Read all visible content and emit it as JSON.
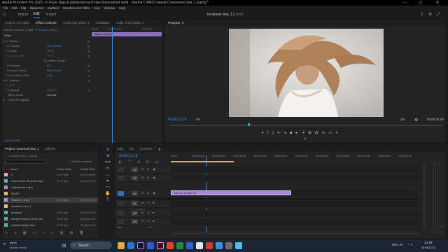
{
  "window": {
    "title": "Adobe Premiere Pro 2023 - F:\\Fiver Gigs & jobs\\External Projects\\Unnamed india - Diamid C\\PRO Diamid C\\renamed new_1.prproj *",
    "controls": "–  ▢  ✕"
  },
  "menu": [
    "File",
    "Edit",
    "Clip",
    "Sequence",
    "Markers",
    "Graphics and Titles",
    "View",
    "Window",
    "Help"
  ],
  "workspace": {
    "tabs": [
      "Import",
      "Edit",
      "Export"
    ],
    "active": "Edit",
    "doc_title": "renamed new_1",
    "doc_status": "Edited"
  },
  "source_panel": {
    "tabs": [
      "Source: (no clips)",
      "Effect Controls",
      "Audio Clip Mixer: 1",
      "Metadata",
      "Audio Track Mixer: 1"
    ],
    "active": "Effect Controls",
    "source_label": "Source • Source_3.mp4",
    "clip_label": "1 • Source_3.mp4",
    "timecode_start": "00;00",
    "timecode_mid": "00;00;16;00",
    "timecode_end": "00;00;32",
    "clip_bar_label": "Source_3.mp4",
    "video_label": "Video",
    "properties": [
      {
        "name": "Motion",
        "value": ""
      },
      {
        "name": "Position",
        "value": "960.0   540.0"
      },
      {
        "name": "Scale",
        "value": "100.0"
      },
      {
        "name": "Scale Width",
        "value": "100.0"
      },
      {
        "name": "",
        "value": "Uniform Scale"
      },
      {
        "name": "Rotation",
        "value": "0.0"
      },
      {
        "name": "Anchor Point",
        "value": "960.0   540.0"
      },
      {
        "name": "Anti-flicker Filter",
        "value": "0.00"
      },
      {
        "name": "Opacity",
        "value": ""
      },
      {
        "name": "Opacity",
        "value": "100.0 %"
      },
      {
        "name": "Blend Mode",
        "value": "Normal"
      },
      {
        "name": "Time Remapping",
        "value": ""
      }
    ],
    "bottom_timecode": "00;00;13;18"
  },
  "program": {
    "tab": "Program: 3",
    "timecode": "00;00;13;18",
    "fit": "Fit",
    "quality": "1/4",
    "duration": "00;00;32;28"
  },
  "project_panel": {
    "tabs": [
      "Project: renamed new_1",
      "Effects"
    ],
    "active": "Project: renamed new_1",
    "project_file": "renamed new_1.prproj",
    "selection_info": "1 of 9 items selected",
    "columns": [
      "Name",
      "Frame Rate",
      "Media Start"
    ],
    "items": [
      {
        "name": "2",
        "rate": "29.97 fps",
        "start": "00;00;00;00",
        "color": "#e8a6d0"
      },
      {
        "name": "2023-06-01 09-43-20.mp4",
        "rate": "29.97 fps",
        "start": "00;00;00;00",
        "color": "#57b3a6"
      },
      {
        "name": "Adjustment Layer",
        "rate": "",
        "start": "",
        "color": "#a890e0"
      },
      {
        "name": "BIGDY",
        "rate": "",
        "start": "",
        "color": "#e0c06a"
      },
      {
        "name": "Source_3.mp4",
        "rate": "29.97 fps",
        "start": "00;00;00;00",
        "color": "#a890e0"
      },
      {
        "name": "renamed new_1",
        "rate": "",
        "start": "",
        "color": "#e0c06a"
      },
      {
        "name": "promace",
        "rate": "29.97 fps",
        "start": "00;00;00;00",
        "color": "#57b3a6"
      },
      {
        "name": "summer-burner-work-edit",
        "rate": "29.97 fps",
        "start": "00;00;00;00",
        "color": "#57b3a6"
      },
      {
        "name": "Untitled Beige Mad",
        "rate": "29.97 fps",
        "start": "00;00;00;00",
        "color": "#57b3a6"
      }
    ]
  },
  "timeline": {
    "tabs": [
      "Edit",
      "B1",
      "promace",
      "3"
    ],
    "active": "3",
    "timecode": "00;00;13;18",
    "ruler": [
      "00;00",
      "00;00;04;00",
      "00;00;08;00",
      "00;00;12;00",
      "00;00;16;00",
      "00;00;20;00",
      "00;00;24;00",
      "00;00;28;00",
      "00;00;32;00",
      "00;00;36;00",
      "00;00;40;00",
      "00;00;44;00"
    ],
    "tracks": [
      "V3",
      "V2",
      "V1",
      "A1",
      "A2",
      "A3"
    ],
    "clip_label": "Source_3.mp4 [V]",
    "audio_label": "Audio 1",
    "mix_label": "Mix",
    "mix_value": "0.0"
  },
  "taskbar": {
    "weather_temp": "29°C",
    "weather_desc": "Mostly cloudy",
    "search": "Search",
    "lang": "ENG IN",
    "time": "13:18",
    "date": "01/06/2023"
  }
}
